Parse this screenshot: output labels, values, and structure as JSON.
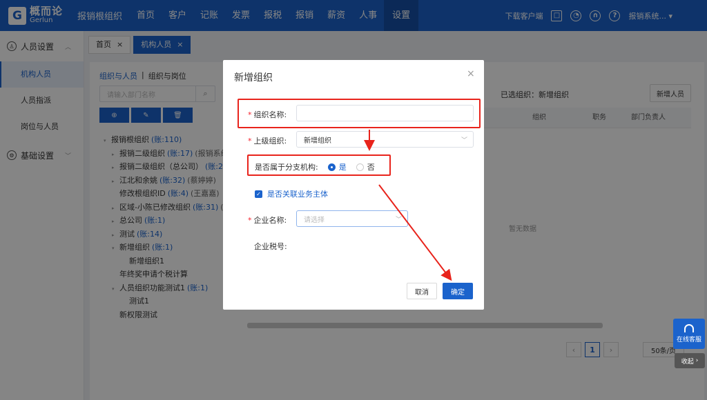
{
  "app": {
    "logo_cn": "概而论",
    "logo_en": "Gerlun",
    "org_name": "报销根组织"
  },
  "nav": [
    "首页",
    "客户",
    "记账",
    "发票",
    "报税",
    "报销",
    "薪资",
    "人事",
    "设置"
  ],
  "topbar": {
    "download": "下载客户端",
    "user": "报销系统... ▾"
  },
  "sidebar": {
    "group1": "人员设置",
    "items": [
      "机构人员",
      "人员指派",
      "岗位与人员"
    ],
    "group2": "基础设置"
  },
  "tabs": [
    {
      "label": "首页",
      "close": "×"
    },
    {
      "label": "机构人员",
      "close": "×"
    }
  ],
  "breadcrumb": {
    "link": "组织与人员",
    "sep": "|",
    "current": "组织与岗位"
  },
  "tree_search": {
    "placeholder": "请输入部门名称"
  },
  "tree": [
    {
      "label": "报销根组织",
      "count": "(账:110)",
      "extra": "",
      "caret": "▾"
    },
    {
      "label": "报销二级组织",
      "count": "(账:17)",
      "extra": "(报销系统",
      "caret": "▸"
    },
    {
      "label": "报销二级组织（总公司）",
      "count": "(账:2)",
      "extra": "",
      "caret": "▸"
    },
    {
      "label": "江北和余姚",
      "count": "(账:32)",
      "extra": "(蔡婷婷)",
      "caret": "▸"
    },
    {
      "label": "修改根组织ID",
      "count": "(账:4)",
      "extra": "(王嘉嘉)",
      "caret": ""
    },
    {
      "label": "区域-小陈已修改组织",
      "count": "(账:31)",
      "extra": "(安",
      "caret": "▸"
    },
    {
      "label": "总公司",
      "count": "(账:1)",
      "extra": "",
      "caret": "▸"
    },
    {
      "label": "测试",
      "count": "(账:14)",
      "extra": "",
      "caret": "▸"
    },
    {
      "label": "新增组织",
      "count": "(账:1)",
      "extra": "",
      "caret": "▾"
    },
    {
      "label": "新增组织1",
      "count": "",
      "extra": "",
      "caret": "",
      "child": true
    },
    {
      "label": "年终奖申请个税计算",
      "count": "",
      "extra": "",
      "caret": ""
    },
    {
      "label": "人员组织功能测试1",
      "count": "(账:1)",
      "extra": "",
      "caret": "▾"
    },
    {
      "label": "测试1",
      "count": "",
      "extra": "",
      "caret": "",
      "child": true
    },
    {
      "label": "新权限测试",
      "count": "",
      "extra": "",
      "caret": ""
    }
  ],
  "right_panel": {
    "selected": "已选组织：新增组织",
    "add_button": "新增人员",
    "columns": [
      "组织",
      "职务",
      "部门负责人"
    ],
    "empty": "暂无数据",
    "page": "1",
    "page_size": "50条/页"
  },
  "dialog": {
    "title": "新增组织",
    "close": "×",
    "org_name_label": "组织名称:",
    "org_name_value": "",
    "parent_label": "上级组织:",
    "parent_value": "新增组织",
    "branch_label": "是否属于分支机构:",
    "yes": "是",
    "no": "否",
    "link_entity": "是否关联业务主体",
    "company_label": "企业名称:",
    "company_placeholder": "请选择",
    "tax_label": "企业税号:",
    "cancel": "取消",
    "confirm": "确定"
  },
  "support": {
    "label": "在线客服",
    "collapse": "收起"
  },
  "colors": {
    "primary": "#1b63cc",
    "annotation": "#e8231b"
  }
}
